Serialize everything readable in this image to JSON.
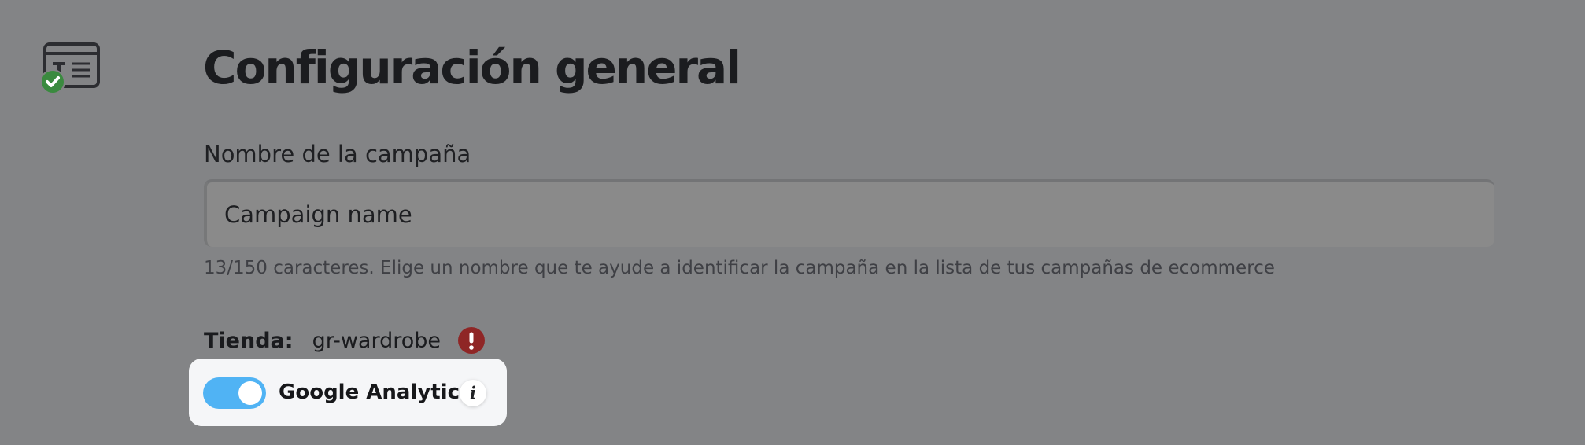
{
  "section": {
    "icon": "text-card-check-icon",
    "title": "Configuración general"
  },
  "campaign_name": {
    "label": "Nombre de la campaña",
    "value": "Campaign name",
    "helper": "13/150 caracteres. Elige un nombre que te ayude a identificar la campaña en la lista de tus campañas de ecommerce"
  },
  "store": {
    "label": "Tienda:",
    "value": "gr-wardrobe",
    "status_icon": "exclamation-alert-icon",
    "status_color": "#8f2626"
  },
  "google_analytics": {
    "label": "Google Analytics",
    "enabled": true,
    "toggle_color": "#50b3f4",
    "info_icon": "info-icon",
    "info_glyph": "i"
  },
  "colors": {
    "overlay": "#838486",
    "card": "#f5f6f8",
    "check_badge": "#3a8a3f"
  }
}
